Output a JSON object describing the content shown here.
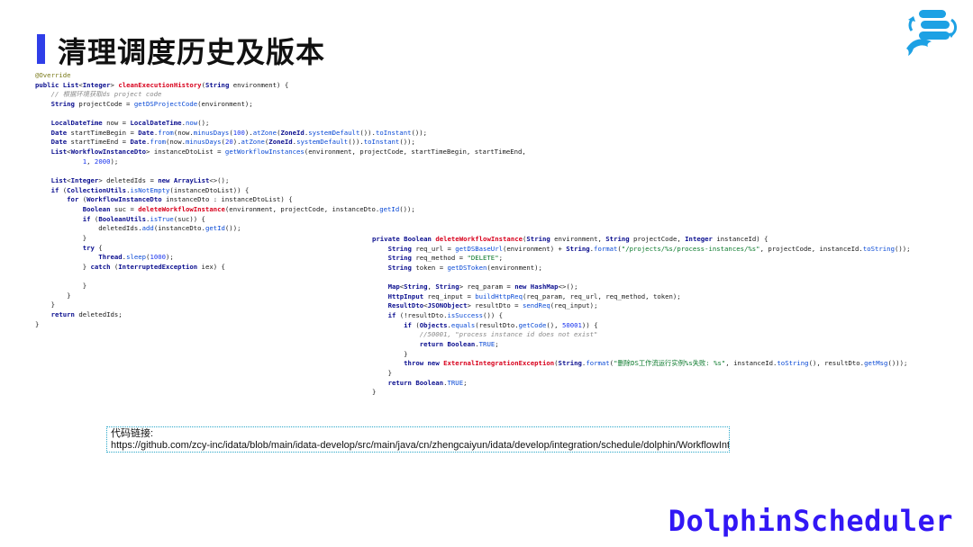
{
  "slide": {
    "title": "清理调度历史及版本"
  },
  "code_left": [
    "@Override",
    "public List<Integer> cleanExecutionHistory(String environment) {",
    "    // 根据环境获取ds project code",
    "    String projectCode = getDSProjectCode(environment);",
    "",
    "    LocalDateTime now = LocalDateTime.now();",
    "    Date startTimeBegin = Date.from(now.minusDays(100).atZone(ZoneId.systemDefault()).toInstant());",
    "    Date startTimeEnd = Date.from(now.minusDays(20).atZone(ZoneId.systemDefault()).toInstant());",
    "    List<WorkflowInstanceDto> instanceDtoList = getWorkflowInstances(environment, projectCode, startTimeBegin, startTimeEnd,",
    "            1, 2000);",
    "",
    "    List<Integer> deletedIds = new ArrayList<>();",
    "    if (CollectionUtils.isNotEmpty(instanceDtoList)) {",
    "        for (WorkflowInstanceDto instanceDto : instanceDtoList) {",
    "            Boolean suc = deleteWorkflowInstance(environment, projectCode, instanceDto.getId());",
    "            if (BooleanUtils.isTrue(suc)) {",
    "                deletedIds.add(instanceDto.getId());",
    "            }",
    "            try {",
    "                Thread.sleep(1000);",
    "            } catch (InterruptedException iex) {",
    "",
    "            }",
    "        }",
    "    }",
    "    return deletedIds;",
    "}"
  ],
  "code_right": [
    "private Boolean deleteWorkflowInstance(String environment, String projectCode, Integer instanceId) {",
    "    String req_url = getDSBaseUrl(environment) + String.format(\"/projects/%s/process-instances/%s\", projectCode, instanceId.toString());",
    "    String req_method = \"DELETE\";",
    "    String token = getDSToken(environment);",
    "",
    "    Map<String, String> req_param = new HashMap<>();",
    "    HttpInput req_input = buildHttpReq(req_param, req_url, req_method, token);",
    "    ResultDto<JSONObject> resultDto = sendReq(req_input);",
    "    if (!resultDto.isSuccess()) {",
    "        if (Objects.equals(resultDto.getCode(), 50001)) {",
    "            //50001, \"process instance id does not exist\"",
    "            return Boolean.TRUE;",
    "        }",
    "        throw new ExternalIntegrationException(String.format(\"删除DS工作流运行实例%s失败: %s\", instanceId.toString(), resultDto.getMsg()));",
    "    }",
    "    return Boolean.TRUE;",
    "}"
  ],
  "link": {
    "label": "代码链接:",
    "url": "https://github.com/zcy-inc/idata/blob/main/idata-develop/src/main/java/cn/zhengcaiyun/idata/develop/integration/schedule/dolphin/WorkflowIntegrator.java"
  },
  "brand": {
    "name": "DolphinScheduler"
  },
  "icons": {
    "logo": "dolphinscheduler-logo-icon"
  },
  "colors": {
    "accent": "#2f3ee8",
    "keyword": "#0b0f8f",
    "method": "#0a4ad6",
    "string": "#0c7a2d",
    "comment": "#8a8a8a",
    "exception": "#d8001c",
    "brand": "#3217f5",
    "logo_blue": "#1da1e4"
  }
}
